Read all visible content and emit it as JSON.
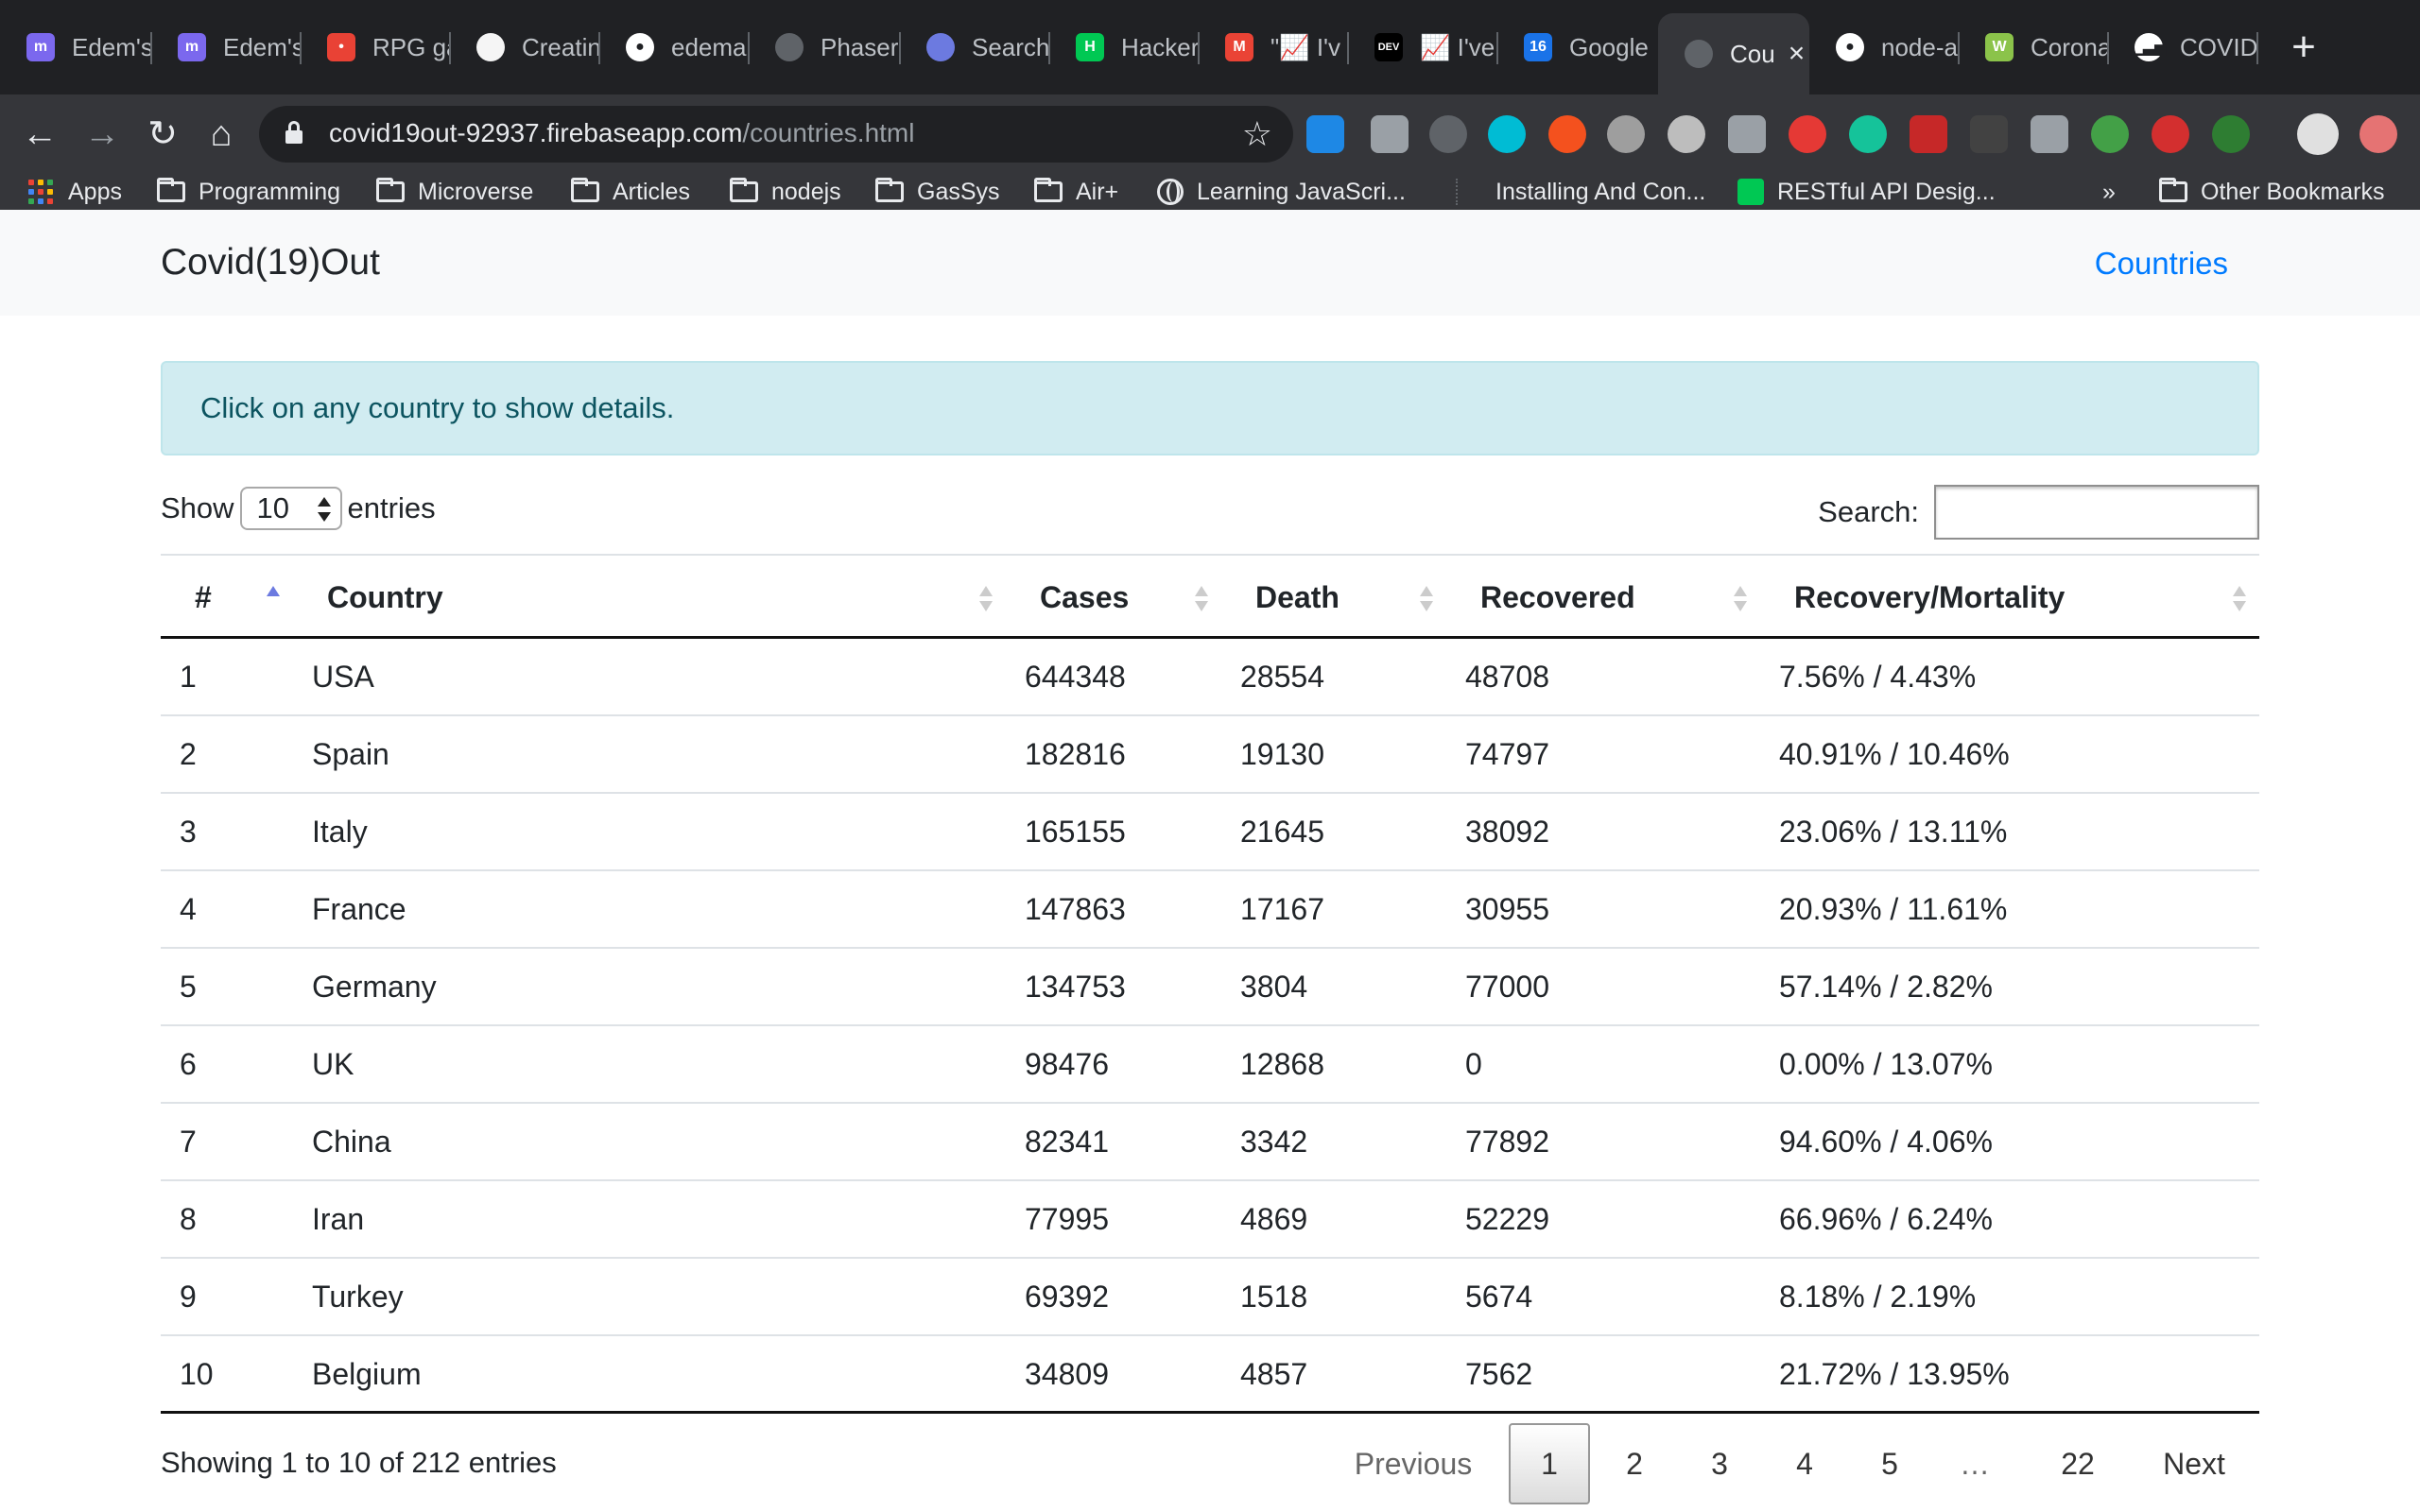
{
  "browser": {
    "tabs": [
      {
        "title": "Edem's",
        "icon": "mozilla-m-icon",
        "color": "#7b68ee"
      },
      {
        "title": "Edem's",
        "icon": "mozilla-m-icon",
        "color": "#7b68ee"
      },
      {
        "title": "RPG ga",
        "icon": "joystick-icon",
        "color": "#e94235"
      },
      {
        "title": "Creatin",
        "icon": "page-icon",
        "color": "#f5f5f5"
      },
      {
        "title": "edema",
        "icon": "github-icon",
        "color": "#ffffff"
      },
      {
        "title": "Phaser",
        "icon": "globe-icon",
        "color": "#5f6368"
      },
      {
        "title": "Search",
        "icon": "search-logo-icon",
        "color": "#6c7ae0"
      },
      {
        "title": "Hacker",
        "icon": "hacker-icon",
        "color": "#00c853"
      },
      {
        "title": "\"📈 I'v",
        "icon": "gmail-icon",
        "color": "#ea4335"
      },
      {
        "title": "📈 I've",
        "icon": "dev-icon",
        "color": "#000000"
      },
      {
        "title": "Google",
        "icon": "calendar-icon",
        "color": "#1a73e8"
      },
      {
        "title": "Cou",
        "icon": "globe-icon",
        "color": "#5f6368",
        "active": true
      },
      {
        "title": "node-a",
        "icon": "github-icon",
        "color": "#ffffff"
      },
      {
        "title": "Corona",
        "icon": "w-icon",
        "color": "#8bc34a"
      },
      {
        "title": "COVID",
        "icon": "bar-chart-icon",
        "color": "#ffffff"
      }
    ],
    "address": {
      "host": "covid19out-92937.firebaseapp.com",
      "path": "/countries.html"
    },
    "bookmarks": [
      {
        "label": "Apps",
        "icon": "apps-grid-icon"
      },
      {
        "label": "Programming",
        "icon": "folder-icon"
      },
      {
        "label": "Microverse",
        "icon": "folder-icon"
      },
      {
        "label": "Articles",
        "icon": "folder-icon"
      },
      {
        "label": "nodejs",
        "icon": "folder-icon"
      },
      {
        "label": "GasSys",
        "icon": "folder-icon"
      },
      {
        "label": "Air+",
        "icon": "folder-icon"
      },
      {
        "label": "Learning JavaScri...",
        "icon": "globe-icon"
      },
      {
        "label": "Installing And Con...",
        "icon": "blank-page-icon"
      },
      {
        "label": "RESTful API Desig...",
        "icon": "hacker-icon"
      },
      {
        "label": "Other Bookmarks",
        "icon": "folder-icon"
      }
    ],
    "overflow_label": "»"
  },
  "site": {
    "brand": "Covid(19)Out",
    "nav_link": "Countries",
    "alert": "Click on any country to show details."
  },
  "table_controls": {
    "show_label": "Show",
    "page_length": "10",
    "entries_label": "entries",
    "search_label": "Search:",
    "search_value": ""
  },
  "table": {
    "columns": [
      "#",
      "Country",
      "Cases",
      "Death",
      "Recovered",
      "Recovery/Mortality"
    ],
    "rows": [
      [
        "1",
        "USA",
        "644348",
        "28554",
        "48708",
        "7.56% / 4.43%"
      ],
      [
        "2",
        "Spain",
        "182816",
        "19130",
        "74797",
        "40.91% / 10.46%"
      ],
      [
        "3",
        "Italy",
        "165155",
        "21645",
        "38092",
        "23.06% / 13.11%"
      ],
      [
        "4",
        "France",
        "147863",
        "17167",
        "30955",
        "20.93% / 11.61%"
      ],
      [
        "5",
        "Germany",
        "134753",
        "3804",
        "77000",
        "57.14% / 2.82%"
      ],
      [
        "6",
        "UK",
        "98476",
        "12868",
        "0",
        "0.00% / 13.07%"
      ],
      [
        "7",
        "China",
        "82341",
        "3342",
        "77892",
        "94.60% / 4.06%"
      ],
      [
        "8",
        "Iran",
        "77995",
        "4869",
        "52229",
        "66.96% / 6.24%"
      ],
      [
        "9",
        "Turkey",
        "69392",
        "1518",
        "5674",
        "8.18% / 2.19%"
      ],
      [
        "10",
        "Belgium",
        "34809",
        "4857",
        "7562",
        "21.72% / 13.95%"
      ]
    ]
  },
  "pagination": {
    "info": "Showing 1 to 10 of 212 entries",
    "previous": "Previous",
    "pages": [
      "1",
      "2",
      "3",
      "4",
      "5",
      "…",
      "22"
    ],
    "current": "1",
    "next": "Next"
  }
}
